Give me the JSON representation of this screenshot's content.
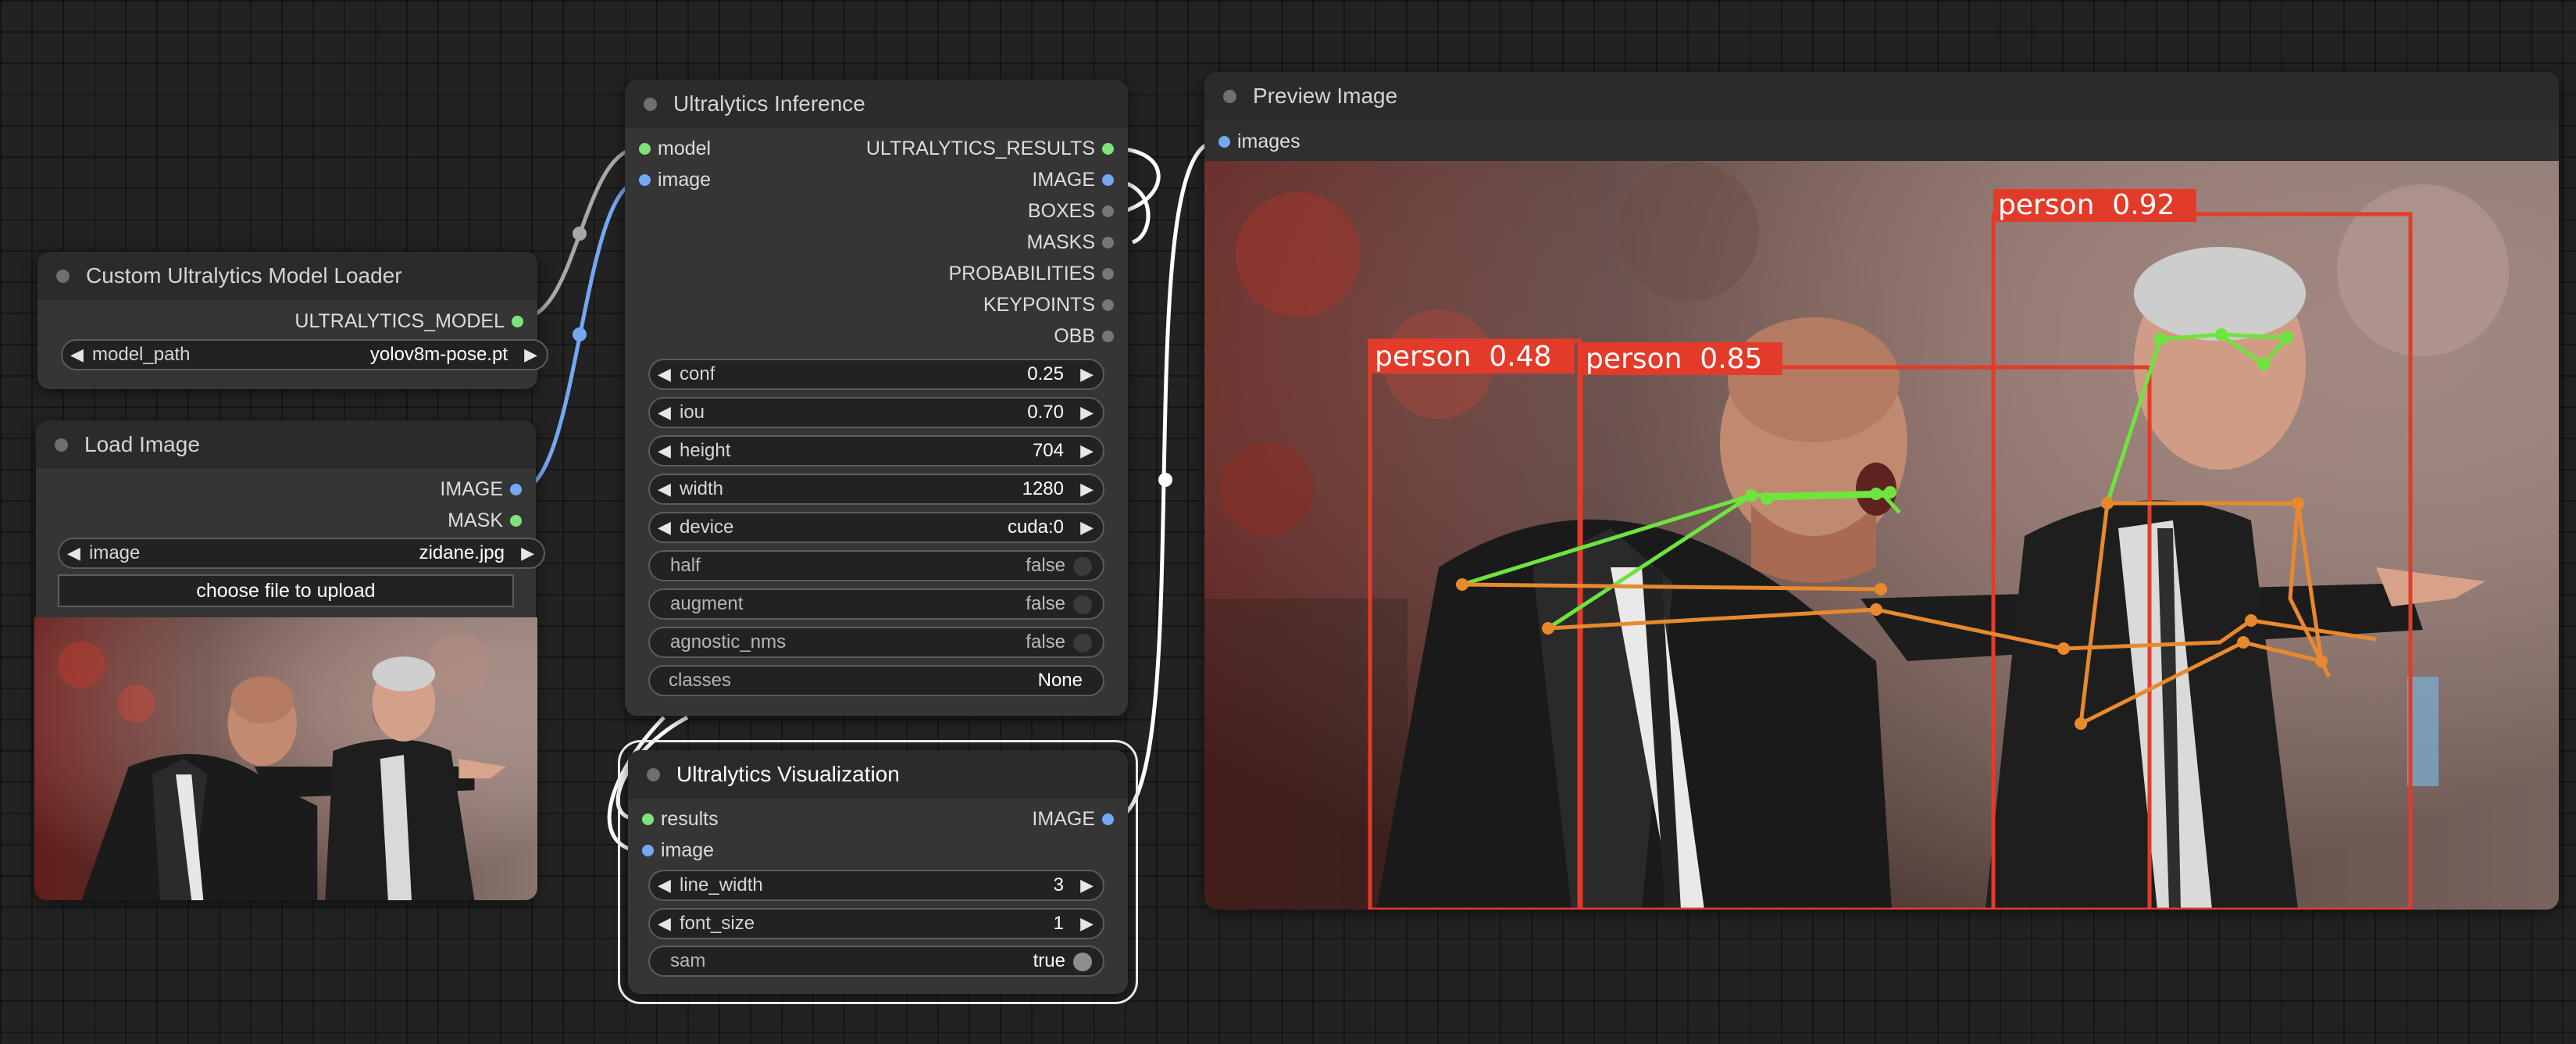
{
  "nodes": {
    "model_loader": {
      "title": "Custom Ultralytics Model Loader",
      "outputs": [
        "ULTRALYTICS_MODEL"
      ],
      "widgets": [
        {
          "label": "model_path",
          "value": "yolov8m-pose.pt"
        }
      ]
    },
    "load_image": {
      "title": "Load Image",
      "outputs": [
        "IMAGE",
        "MASK"
      ],
      "widgets": [
        {
          "label": "image",
          "value": "zidane.jpg"
        }
      ],
      "upload_label": "choose file to upload"
    },
    "inference": {
      "title": "Ultralytics Inference",
      "inputs": [
        "model",
        "image"
      ],
      "outputs": [
        "ULTRALYTICS_RESULTS",
        "IMAGE",
        "BOXES",
        "MASKS",
        "PROBABILITIES",
        "KEYPOINTS",
        "OBB"
      ],
      "widgets": [
        {
          "label": "conf",
          "value": "0.25"
        },
        {
          "label": "iou",
          "value": "0.70"
        },
        {
          "label": "height",
          "value": "704"
        },
        {
          "label": "width",
          "value": "1280"
        },
        {
          "label": "device",
          "value": "cuda:0"
        }
      ],
      "toggles": [
        {
          "label": "half",
          "value": "false"
        },
        {
          "label": "augment",
          "value": "false"
        },
        {
          "label": "agnostic_nms",
          "value": "false"
        }
      ],
      "plain": [
        {
          "label": "classes",
          "value": "None"
        }
      ]
    },
    "visualization": {
      "title": "Ultralytics Visualization",
      "inputs": [
        "results",
        "image"
      ],
      "outputs": [
        "IMAGE"
      ],
      "widgets": [
        {
          "label": "line_width",
          "value": "3"
        },
        {
          "label": "font_size",
          "value": "1"
        }
      ],
      "toggles": [
        {
          "label": "sam",
          "value": "true"
        }
      ]
    },
    "preview": {
      "title": "Preview Image",
      "inputs": [
        "images"
      ],
      "detections": [
        {
          "label": "person  0.48"
        },
        {
          "label": "person  0.85"
        },
        {
          "label": "person  0.92"
        }
      ]
    }
  },
  "colors": {
    "model_link": "#a8a8a8",
    "image_link": "#74a8f2",
    "results_link": "#ffffff",
    "box": "#e33b2a",
    "keypoint_upper": "#6ee43e",
    "keypoint_lower": "#e8892e"
  },
  "icons": [
    "arrow-left-icon",
    "arrow-right-icon",
    "status-dot-icon",
    "toggle-knob-icon"
  ]
}
